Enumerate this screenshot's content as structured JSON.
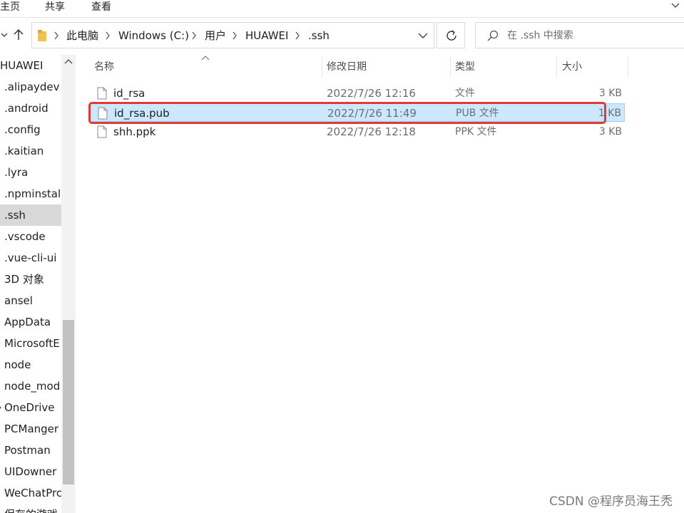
{
  "ribbon": {
    "tabs": [
      "主页",
      "共享",
      "查看"
    ]
  },
  "address": {
    "crumbs": [
      "此电脑",
      "Windows (C:)",
      "用户",
      "HUAWEI",
      ".ssh"
    ]
  },
  "search": {
    "placeholder": "在 .ssh 中搜索"
  },
  "nav_pane": {
    "items": [
      {
        "label": "HUAWEI"
      },
      {
        "label": ".alipaydev"
      },
      {
        "label": ".android"
      },
      {
        "label": ".config"
      },
      {
        "label": ".kaitian"
      },
      {
        "label": ".lyra"
      },
      {
        "label": ".npminstall"
      },
      {
        "label": ".ssh",
        "selected": true
      },
      {
        "label": ".vscode"
      },
      {
        "label": ".vue-cli-ui"
      },
      {
        "label": "3D 对象"
      },
      {
        "label": "ansel"
      },
      {
        "label": "AppData"
      },
      {
        "label": "MicrosoftE"
      },
      {
        "label": "node"
      },
      {
        "label": "node_mod"
      },
      {
        "label": "OneDrive"
      },
      {
        "label": "PCManger"
      },
      {
        "label": "Postman"
      },
      {
        "label": "UIDowner"
      },
      {
        "label": "WeChatPrc"
      },
      {
        "label": "保存的游戏"
      }
    ]
  },
  "file_list": {
    "columns": {
      "name": "名称",
      "date": "修改日期",
      "type": "类型",
      "size": "大小"
    },
    "rows": [
      {
        "name": "id_rsa",
        "date": "2022/7/26 12:16",
        "type": "文件",
        "size": "3 KB"
      },
      {
        "name": "id_rsa.pub",
        "date": "2022/7/26 11:49",
        "type": "PUB 文件",
        "size": "1 KB",
        "selected": true
      },
      {
        "name": "shh.ppk",
        "date": "2022/7/26 12:18",
        "type": "PPK 文件",
        "size": "3 KB"
      }
    ]
  },
  "watermark": "CSDN @程序员海王秃",
  "colors": {
    "selection_fill": "#cce8ff",
    "selection_border": "#99d1ff",
    "highlight_outline": "#e53935",
    "nav_selected": "#d9d9d9"
  }
}
